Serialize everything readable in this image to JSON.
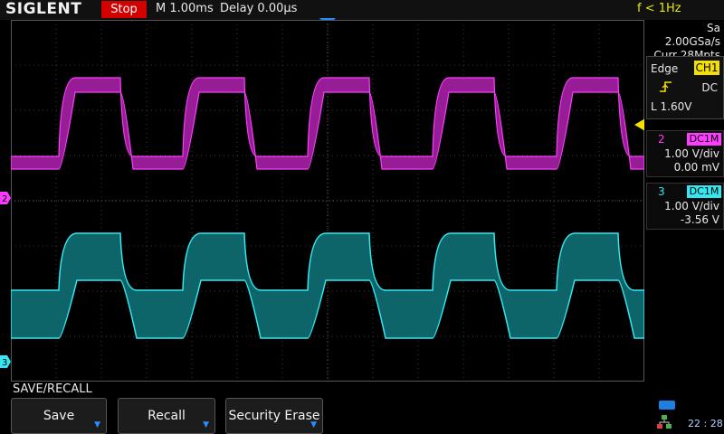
{
  "header": {
    "brand": "SIGLENT",
    "run_state": "Stop",
    "timebase": "M 1.00ms",
    "delay": "Delay 0.00µs",
    "frequency": "f < 1Hz"
  },
  "acquisition": {
    "sample_rate": "Sa 2.00GSa/s",
    "memory_depth": "Curr 28Mpts"
  },
  "trigger": {
    "mode": "Edge",
    "source": "CH1",
    "coupling": "DC",
    "level": "L  1.60V",
    "slope_icon": "rising-edge-icon"
  },
  "channels": [
    {
      "number": "2",
      "coupling": "DC1M",
      "scale": "1.00 V/div",
      "offset": "0.00 mV",
      "color": "#ff3cff"
    },
    {
      "number": "3",
      "coupling": "DC1M",
      "scale": "1.00 V/div",
      "offset": "-3.56 V",
      "color": "#33e8f0"
    }
  ],
  "menu": {
    "title": "SAVE/RECALL",
    "softkeys": [
      {
        "label": "Save"
      },
      {
        "label": "Recall"
      },
      {
        "label": "Security Erase"
      }
    ]
  },
  "status": {
    "clock": "22 : 28",
    "usb_icon": "usb-icon",
    "network_icon": "network-icon"
  },
  "colors": {
    "ch2": "#ff3cff",
    "ch3": "#33e8f0",
    "trigger": "#f3e000",
    "stop": "#d40000",
    "accent": "#2a8cff"
  }
}
